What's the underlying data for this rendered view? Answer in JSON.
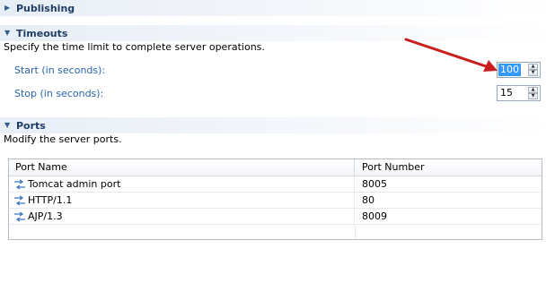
{
  "sections": {
    "publishing": {
      "title": "Publishing",
      "expanded": false
    },
    "timeouts": {
      "title": "Timeouts",
      "expanded": true,
      "description": "Specify the time limit to complete server operations.",
      "start_label": "Start (in seconds):",
      "start_value": "100",
      "stop_label": "Stop (in seconds):",
      "stop_value": "15"
    },
    "ports": {
      "title": "Ports",
      "expanded": true,
      "description": "Modify the server ports.",
      "columns": [
        "Port Name",
        "Port Number"
      ],
      "rows": [
        {
          "name": "Tomcat admin port",
          "number": "8005",
          "icon": "port-icon"
        },
        {
          "name": "HTTP/1.1",
          "number": "80",
          "icon": "port-icon"
        },
        {
          "name": "AJP/1.3",
          "number": "8009",
          "icon": "port-icon"
        }
      ]
    }
  },
  "colors": {
    "header_title": "#1f3d66",
    "field_label": "#2a64ad",
    "selection": "#3399ff",
    "arrow": "#d42020"
  }
}
